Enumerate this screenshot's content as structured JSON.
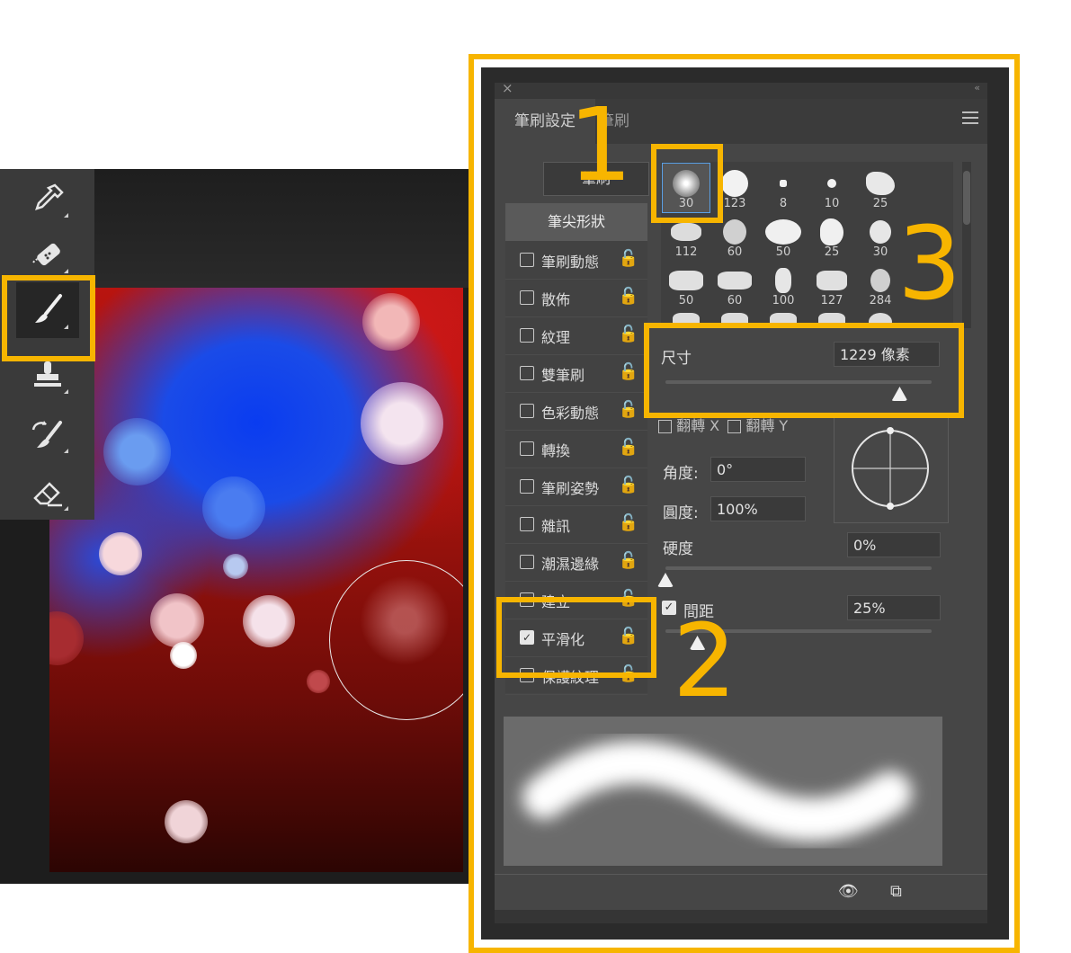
{
  "panel": {
    "close_glyph": "×",
    "collapse_glyph": "‹‹",
    "tabs": [
      "筆刷設定",
      "筆刷"
    ],
    "brushes_button": "筆刷",
    "tip_shape_label": "筆尖形狀",
    "options": [
      {
        "label": "筆刷動態",
        "checked": false
      },
      {
        "label": "散佈",
        "checked": false
      },
      {
        "label": "紋理",
        "checked": false
      },
      {
        "label": "雙筆刷",
        "checked": false
      },
      {
        "label": "色彩動態",
        "checked": false
      },
      {
        "label": "轉換",
        "checked": false
      },
      {
        "label": "筆刷姿勢",
        "checked": false
      },
      {
        "label": "雜訊",
        "checked": false
      },
      {
        "label": "潮濕邊緣",
        "checked": false
      },
      {
        "label": "建立",
        "checked": false
      },
      {
        "label": "平滑化",
        "checked": true
      },
      {
        "label": "保護紋理",
        "checked": false
      }
    ],
    "presets": [
      "30",
      "123",
      "8",
      "10",
      "25",
      "112",
      "60",
      "50",
      "25",
      "30",
      "50",
      "60",
      "100",
      "127",
      "284"
    ],
    "size_label": "尺寸",
    "size_value": "1229 像素",
    "size_slider_fraction": 0.88,
    "flip_x": "翻轉 X",
    "flip_y": "翻轉 Y",
    "angle_label": "角度:",
    "angle_value": "0°",
    "roundness_label": "圓度:",
    "roundness_value": "100%",
    "hardness_label": "硬度",
    "hardness_value": "0%",
    "hardness_fraction": 0.0,
    "spacing_label": "間距",
    "spacing_value": "25%",
    "spacing_checked": true,
    "spacing_fraction": 0.12
  },
  "callouts": [
    "1",
    "2",
    "3"
  ],
  "colors": {
    "highlight": "#f7b500",
    "panel_bg": "#464646"
  },
  "tools": [
    "eyedropper-icon",
    "healing-brush-icon",
    "brush-icon",
    "stamp-icon",
    "history-brush-icon",
    "eraser-icon"
  ]
}
